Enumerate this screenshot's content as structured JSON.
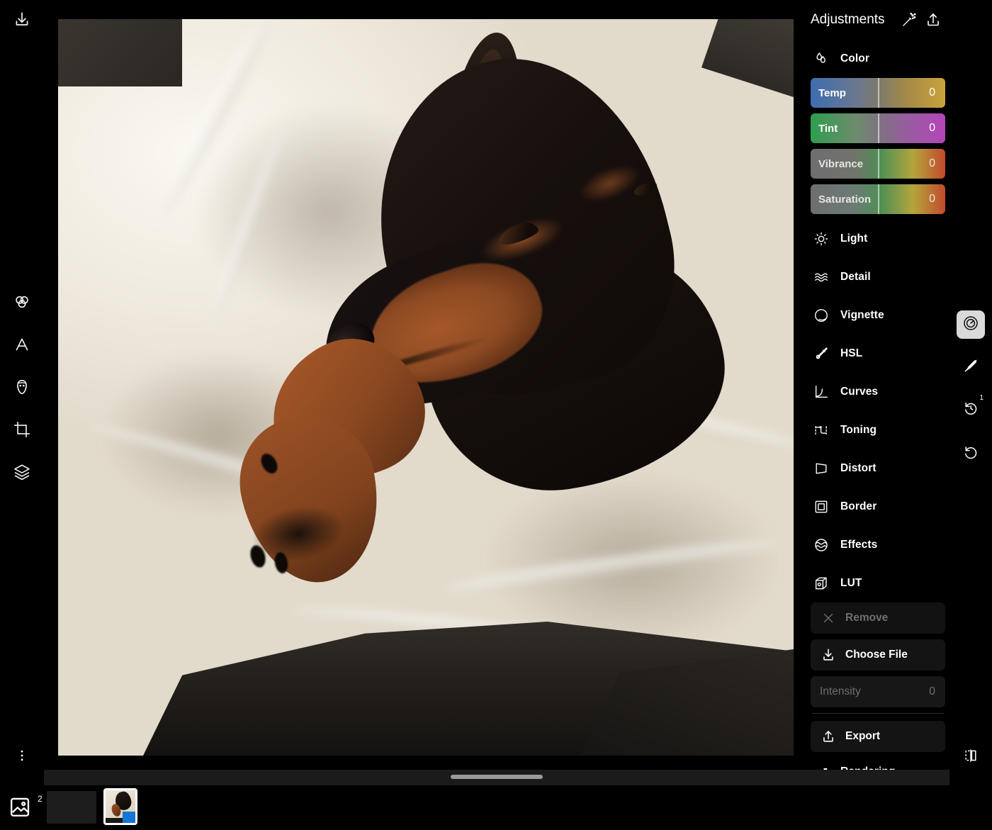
{
  "app": {
    "canvas_background": "#000000",
    "accent_blue": "#1676d4"
  },
  "left_rail": {
    "items": [
      {
        "icon": "import-download-icon",
        "name": "import-tool"
      },
      {
        "icon": "color-circles-icon",
        "name": "color-tool"
      },
      {
        "icon": "text-a-icon",
        "name": "text-tool"
      },
      {
        "icon": "face-retouch-icon",
        "name": "retouch-tool"
      },
      {
        "icon": "crop-icon",
        "name": "crop-tool"
      },
      {
        "icon": "layers-icon",
        "name": "layers-tool"
      },
      {
        "icon": "kebab-menu-icon",
        "name": "more-options"
      }
    ]
  },
  "panel": {
    "title": "Adjustments",
    "header_icons": [
      {
        "icon": "magic-wand-icon",
        "name": "auto-enhance-button"
      },
      {
        "icon": "share-upload-icon",
        "name": "share-button"
      }
    ],
    "color_section": {
      "label": "Color",
      "icon": "droplets-icon",
      "sliders": [
        {
          "label": "Temp",
          "value": "0"
        },
        {
          "label": "Tint",
          "value": "0"
        },
        {
          "label": "Vibrance",
          "value": "0"
        },
        {
          "label": "Saturation",
          "value": "0"
        }
      ]
    },
    "sections": [
      {
        "label": "Light",
        "icon": "sun-icon"
      },
      {
        "label": "Detail",
        "icon": "waves-icon"
      },
      {
        "label": "Vignette",
        "icon": "vignette-circle-icon"
      },
      {
        "label": "HSL",
        "icon": "dropper-brush-icon"
      },
      {
        "label": "Curves",
        "icon": "curves-graph-icon"
      },
      {
        "label": "Toning",
        "icon": "toning-node-icon"
      },
      {
        "label": "Distort",
        "icon": "distort-quad-icon"
      },
      {
        "label": "Border",
        "icon": "border-square-icon"
      },
      {
        "label": "Effects",
        "icon": "effects-globe-icon"
      },
      {
        "label": "LUT",
        "icon": "lut-cube-icon"
      }
    ],
    "lut_controls": {
      "remove_label": "Remove",
      "remove_icon": "close-x-icon",
      "choose_file_label": "Choose File",
      "choose_file_icon": "download-icon",
      "intensity_label": "Intensity",
      "intensity_value": "0"
    },
    "export": {
      "label": "Export",
      "icon": "share-upload-icon"
    },
    "rendering": {
      "label": "Rendering",
      "icon": "grid-blocks-icon"
    }
  },
  "right_strip": {
    "items": [
      {
        "name": "adjust-dial-button",
        "icon": "gauge-dial-icon",
        "state": "active",
        "badge": ""
      },
      {
        "name": "brush-mask-button",
        "icon": "brush-slash-icon",
        "state": "normal",
        "badge": ""
      },
      {
        "name": "history-button",
        "icon": "history-undo-icon",
        "state": "normal",
        "badge": "1"
      },
      {
        "name": "reset-button",
        "icon": "reset-rotate-icon",
        "state": "normal",
        "badge": ""
      },
      {
        "name": "compare-button",
        "icon": "before-after-split-icon",
        "state": "normal",
        "badge": ""
      }
    ]
  },
  "filmstrip": {
    "library_icon": "photo-library-icon",
    "library_count": "2"
  }
}
